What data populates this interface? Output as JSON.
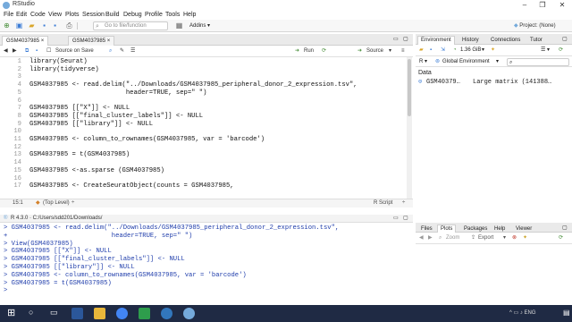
{
  "window": {
    "title": "RStudio"
  },
  "menu": [
    "File",
    "Edit",
    "Code",
    "View",
    "Plots",
    "Session",
    "Build",
    "Debug",
    "Profile",
    "Tools",
    "Help"
  ],
  "toolbar": {
    "goto_placeholder": "Go to file/function",
    "addins_label": "Addins",
    "project_label": "Project: (None)"
  },
  "editor": {
    "tabs": [
      "GSM4037985",
      "GSM4037985"
    ],
    "source_on_save": "Source on Save",
    "run_label": "Run",
    "source_label": "Source",
    "lines": [
      {
        "n": "1",
        "code": "library(Seurat)"
      },
      {
        "n": "2",
        "code": "library(tidyverse)"
      },
      {
        "n": "3",
        "code": ""
      },
      {
        "n": "4",
        "code": "GSM4037985 <- read.delim(\"../Downloads/GSM4037985_peripheral_donor_2_expression.tsv\","
      },
      {
        "n": "5",
        "code": "                         header=TRUE, sep=\" \")"
      },
      {
        "n": "6",
        "code": ""
      },
      {
        "n": "7",
        "code": "GSM4037985 [[\"X\"]] <- NULL"
      },
      {
        "n": "8",
        "code": "GSM4037985 [[\"final_cluster_labels\"]] <- NULL"
      },
      {
        "n": "9",
        "code": "GSM4037985 [[\"library\"]] <- NULL"
      },
      {
        "n": "10",
        "code": ""
      },
      {
        "n": "11",
        "code": "GSM4037985 <- column_to_rownames(GSM4037985, var = 'barcode')"
      },
      {
        "n": "12",
        "code": ""
      },
      {
        "n": "13",
        "code": "GSM4037985 = t(GSM4037985)"
      },
      {
        "n": "14",
        "code": ""
      },
      {
        "n": "15",
        "code": "GSM4037985 <-as.sparse (GSM4037985)"
      },
      {
        "n": "16",
        "code": ""
      },
      {
        "n": "17",
        "code": "GSM4037985 <- CreateSeuratObject(counts = GSM4037985,"
      }
    ],
    "status_pos": "15:1",
    "status_scope": "(Top Level)",
    "status_type": "R Script"
  },
  "console": {
    "header": "R 4.3.0 · C:/Users/sdd201/Downloads/",
    "lines": [
      "> GSM4037985 <- read.delim(\"../Downloads/GSM4037985_peripheral_donor_2_expression.tsv\",",
      "+                           header=TRUE, sep=\" \")",
      "> View(GSM4037985)",
      "> GSM4037985 [[\"X\"]] <- NULL",
      "> GSM4037985 [[\"final_cluster_labels\"]] <- NULL",
      "> GSM4037985 [[\"library\"]] <- NULL",
      "> GSM4037985 <- column_to_rownames(GSM4037985, var = 'barcode')",
      "> GSM4037985 = t(GSM4037985)",
      ">"
    ]
  },
  "environment": {
    "tabs": [
      "Environment",
      "History",
      "Connections",
      "Tutor"
    ],
    "memory": "1.36 GiB",
    "r_label": "R",
    "scope": "Global Environment",
    "section": "Data",
    "item_name": "GSM40379…",
    "item_value": "Large matrix (141388…"
  },
  "files": {
    "tabs": [
      "Files",
      "Plots",
      "Packages",
      "Help",
      "Viewer"
    ],
    "zoom": "Zoom",
    "export": "Export"
  },
  "taskbar": {
    "lang": "ENG"
  },
  "colors": {
    "accent": "#75aadb",
    "taskbar": "#1f2a44",
    "console_text": "#1f3dab"
  }
}
